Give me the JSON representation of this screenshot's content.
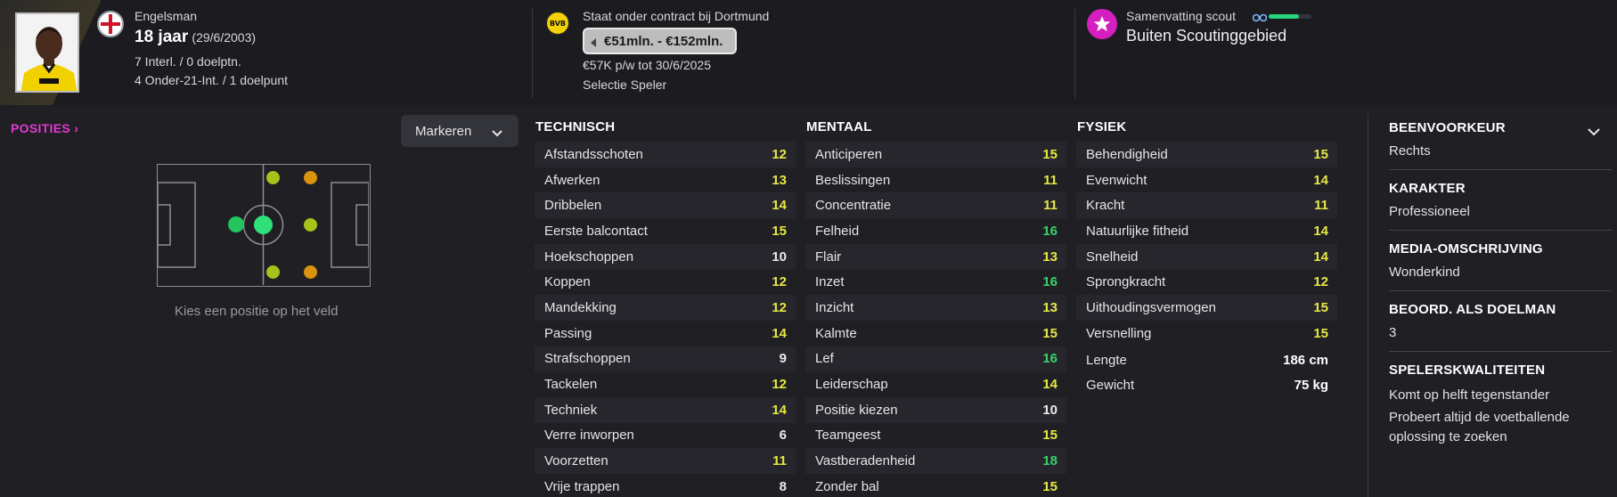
{
  "header": {
    "nationality": "Engelsman",
    "age": "18 jaar",
    "birthdate": "(29/6/2003)",
    "caps": "7 Interl. / 0 doelptn.",
    "u21_caps": "4 Onder-21-Int. / 1 doelpunt",
    "contract": "Staat onder contract bij Dortmund",
    "club_badge_text": "BVB",
    "value_range": "€51mln. - €152mln.",
    "wage": "€57K p/w tot 30/6/2025",
    "squad_status": "Selectie Speler",
    "scout_title": "Samenvatting scout",
    "scout_status": "Buiten Scoutinggebied",
    "scout_bar_level": 0.7
  },
  "positions": {
    "title": "POSITIES",
    "mark_button": "Markeren",
    "hint": "Kies een positie op het veld"
  },
  "technical": {
    "title": "TECHNISCH",
    "rows": [
      {
        "name": "Afstandsschoten",
        "value": "12"
      },
      {
        "name": "Afwerken",
        "value": "13"
      },
      {
        "name": "Dribbelen",
        "value": "14"
      },
      {
        "name": "Eerste balcontact",
        "value": "15"
      },
      {
        "name": "Hoekschoppen",
        "value": "10"
      },
      {
        "name": "Koppen",
        "value": "12"
      },
      {
        "name": "Mandekking",
        "value": "12"
      },
      {
        "name": "Passing",
        "value": "14"
      },
      {
        "name": "Strafschoppen",
        "value": "9"
      },
      {
        "name": "Tackelen",
        "value": "12"
      },
      {
        "name": "Techniek",
        "value": "14"
      },
      {
        "name": "Verre inworpen",
        "value": "6"
      },
      {
        "name": "Voorzetten",
        "value": "11"
      },
      {
        "name": "Vrije trappen",
        "value": "8"
      }
    ]
  },
  "mental": {
    "title": "MENTAAL",
    "rows": [
      {
        "name": "Anticiperen",
        "value": "15"
      },
      {
        "name": "Beslissingen",
        "value": "11"
      },
      {
        "name": "Concentratie",
        "value": "11"
      },
      {
        "name": "Felheid",
        "value": "16"
      },
      {
        "name": "Flair",
        "value": "13"
      },
      {
        "name": "Inzet",
        "value": "16"
      },
      {
        "name": "Inzicht",
        "value": "13"
      },
      {
        "name": "Kalmte",
        "value": "15"
      },
      {
        "name": "Lef",
        "value": "16"
      },
      {
        "name": "Leiderschap",
        "value": "14"
      },
      {
        "name": "Positie kiezen",
        "value": "10"
      },
      {
        "name": "Teamgeest",
        "value": "15"
      },
      {
        "name": "Vastberadenheid",
        "value": "18"
      },
      {
        "name": "Zonder bal",
        "value": "15"
      }
    ]
  },
  "physical": {
    "title": "FYSIEK",
    "rows": [
      {
        "name": "Behendigheid",
        "value": "15"
      },
      {
        "name": "Evenwicht",
        "value": "14"
      },
      {
        "name": "Kracht",
        "value": "11"
      },
      {
        "name": "Natuurlijke fitheid",
        "value": "14"
      },
      {
        "name": "Snelheid",
        "value": "14"
      },
      {
        "name": "Sprongkracht",
        "value": "12"
      },
      {
        "name": "Uithoudingsvermogen",
        "value": "15"
      },
      {
        "name": "Versnelling",
        "value": "15"
      }
    ],
    "height_label": "Lengte",
    "height": "186 cm",
    "weight_label": "Gewicht",
    "weight": "75 kg"
  },
  "info": {
    "foot_title": "BEENVOORKEUR",
    "foot": "Rechts",
    "personality_title": "KARAKTER",
    "personality": "Professioneel",
    "media_title": "MEDIA-OMSCHRIJVING",
    "media": "Wonderkind",
    "gk_title": "BEOORD. ALS DOELMAN",
    "gk": "3",
    "traits_title": "SPELERSKWALITEITEN",
    "traits": [
      "Komt op helft tegenstander",
      "Probeert altijd de voetballende oplossing te zoeken"
    ]
  },
  "colors": {
    "green_value": "#39d26b",
    "yellow_value": "#e8e844",
    "white_value": "#eaeaea",
    "accent": "#e13ad0"
  }
}
